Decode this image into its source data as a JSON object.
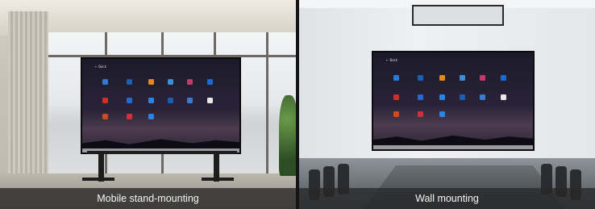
{
  "panels": [
    {
      "caption": "Mobile stand-mounting",
      "screen_header": "← Back"
    },
    {
      "caption": "Wall mounting",
      "screen_header": "← Back"
    }
  ],
  "colors": {
    "caption_bg": "#282828",
    "caption_text": "#f4f4f4",
    "screen_dark": "#1b1a2a"
  },
  "icons": [
    "back-arrow-icon",
    "app-icon"
  ]
}
